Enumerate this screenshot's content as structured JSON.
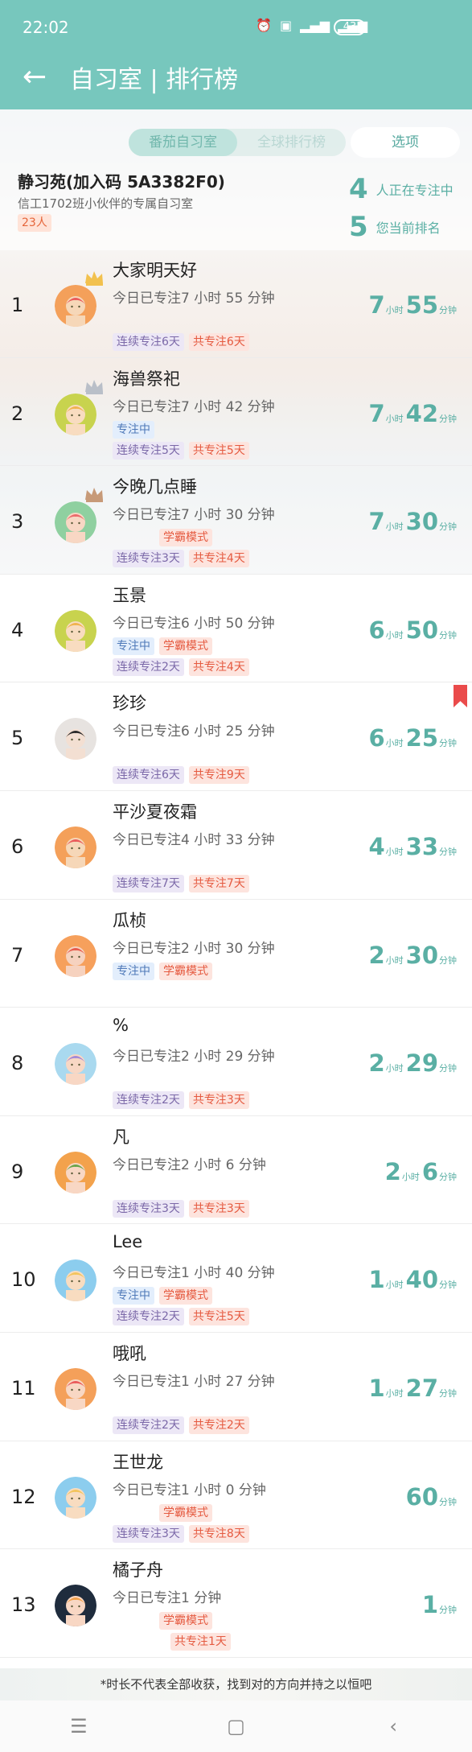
{
  "status_bar": {
    "time": "22:02",
    "icons": [
      "alarm-icon",
      "hd-icon",
      "4g-signal-icon",
      "wifi-signal-icon"
    ],
    "battery": "43"
  },
  "titlebar": {
    "back_icon": "arrow-left-icon",
    "title": "自习室 | 排行榜"
  },
  "tabs": {
    "pomodoro_room": "番茄自习室",
    "global_rank": "全球排行榜",
    "options": "选项"
  },
  "room": {
    "name": "静习苑(加入码 5A3382F0)",
    "description": "信工1702班小伙伴的专属自习室",
    "member_count": "23人",
    "focusing_count": "4",
    "focusing_label": "人正在专注中",
    "my_rank": "5",
    "my_rank_label": "您当前排名"
  },
  "labels": {
    "hour": "小时",
    "minute": "分钟"
  },
  "ranking": [
    {
      "rank": "1",
      "name": "大家明天好",
      "desc": "今日已专注7 小时 55 分钟",
      "status_tags": [],
      "tags": [
        {
          "text": "连续专注6天",
          "color": "purple"
        },
        {
          "text": "共专注6天",
          "color": "red"
        }
      ],
      "hours": "7",
      "minutes": "55",
      "crown": "gold",
      "avatar": "orange"
    },
    {
      "rank": "2",
      "name": "海兽祭祀",
      "desc": "今日已专注7 小时 42 分钟",
      "status_tags": [
        {
          "text": "专注中",
          "color": "blue"
        }
      ],
      "tags": [
        {
          "text": "连续专注5天",
          "color": "purple"
        },
        {
          "text": "共专注5天",
          "color": "red"
        }
      ],
      "hours": "7",
      "minutes": "42",
      "crown": "silver",
      "avatar": "yellow-green"
    },
    {
      "rank": "3",
      "name": "今晚几点睡",
      "desc": "今日已专注7 小时 30 分钟",
      "status_tags": [
        {
          "text": "学霸模式",
          "color": "red",
          "offset": true
        }
      ],
      "tags": [
        {
          "text": "连续专注3天",
          "color": "purple"
        },
        {
          "text": "共专注4天",
          "color": "red"
        }
      ],
      "hours": "7",
      "minutes": "30",
      "crown": "bronze",
      "avatar": "green"
    },
    {
      "rank": "4",
      "name": "玉景",
      "desc": "今日已专注6 小时 50 分钟",
      "status_tags": [
        {
          "text": "专注中",
          "color": "blue"
        },
        {
          "text": "学霸模式",
          "color": "red"
        }
      ],
      "tags": [
        {
          "text": "连续专注2天",
          "color": "purple"
        },
        {
          "text": "共专注4天",
          "color": "red"
        }
      ],
      "hours": "6",
      "minutes": "50",
      "crown": "",
      "avatar": "yellow-green"
    },
    {
      "rank": "5",
      "name": "珍珍",
      "desc": "今日已专注6 小时 25 分钟",
      "status_tags": [],
      "tags": [
        {
          "text": "连续专注6天",
          "color": "purple"
        },
        {
          "text": "共专注9天",
          "color": "red"
        }
      ],
      "hours": "6",
      "minutes": "25",
      "crown": "",
      "avatar": "photo"
    },
    {
      "rank": "6",
      "name": "平沙夏夜霜",
      "desc": "今日已专注4 小时 33 分钟",
      "status_tags": [],
      "tags": [
        {
          "text": "连续专注7天",
          "color": "purple"
        },
        {
          "text": "共专注7天",
          "color": "red"
        }
      ],
      "hours": "4",
      "minutes": "33",
      "crown": "",
      "avatar": "orange"
    },
    {
      "rank": "7",
      "name": "瓜桢",
      "desc": "今日已专注2 小时 30 分钟",
      "status_tags": [
        {
          "text": "专注中",
          "color": "blue"
        },
        {
          "text": "学霸模式",
          "color": "red"
        }
      ],
      "tags": [],
      "hours": "2",
      "minutes": "30",
      "crown": "",
      "avatar": "orange-red"
    },
    {
      "rank": "8",
      "name": "%",
      "desc": "今日已专注2 小时 29 分钟",
      "status_tags": [],
      "tags": [
        {
          "text": "连续专注2天",
          "color": "purple"
        },
        {
          "text": "共专注3天",
          "color": "red"
        }
      ],
      "hours": "2",
      "minutes": "29",
      "crown": "",
      "avatar": "blue-purple"
    },
    {
      "rank": "9",
      "name": "凡",
      "desc": "今日已专注2 小时 6 分钟",
      "status_tags": [],
      "tags": [
        {
          "text": "连续专注3天",
          "color": "purple"
        },
        {
          "text": "共专注3天",
          "color": "red"
        }
      ],
      "hours": "2",
      "minutes": "6",
      "crown": "",
      "avatar": "orange-green"
    },
    {
      "rank": "10",
      "name": "Lee",
      "desc": "今日已专注1 小时 40 分钟",
      "status_tags": [
        {
          "text": "专注中",
          "color": "blue"
        },
        {
          "text": "学霸模式",
          "color": "red"
        }
      ],
      "tags": [
        {
          "text": "连续专注2天",
          "color": "purple"
        },
        {
          "text": "共专注5天",
          "color": "red"
        }
      ],
      "hours": "1",
      "minutes": "40",
      "crown": "",
      "avatar": "blue-yellow"
    },
    {
      "rank": "11",
      "name": "哦吼",
      "desc": "今日已专注1 小时 27 分钟",
      "status_tags": [],
      "tags": [
        {
          "text": "连续专注2天",
          "color": "purple"
        },
        {
          "text": "共专注2天",
          "color": "red"
        }
      ],
      "hours": "1",
      "minutes": "27",
      "crown": "",
      "avatar": "orange-green2"
    },
    {
      "rank": "12",
      "name": "王世龙",
      "desc": "今日已专注1 小时 0 分钟",
      "status_tags": [
        {
          "text": "学霸模式",
          "color": "red",
          "offset": true
        }
      ],
      "tags": [
        {
          "text": "连续专注3天",
          "color": "purple"
        },
        {
          "text": "共专注8天",
          "color": "red"
        }
      ],
      "hours": "",
      "minutes": "60",
      "crown": "",
      "avatar": "blue-yellow"
    },
    {
      "rank": "13",
      "name": "橘子舟",
      "desc": "今日已专注1 分钟",
      "status_tags": [
        {
          "text": "学霸模式",
          "color": "red",
          "offset": true
        }
      ],
      "tags": [
        {
          "text": "共专注1天",
          "color": "red",
          "offset2": true
        }
      ],
      "hours": "",
      "minutes": "1",
      "crown": "",
      "avatar": "dark"
    }
  ],
  "footer_note": "*时长不代表全部收获，找到对的方向并持之以恒吧",
  "nav": {
    "menu_icon": "☰",
    "home_icon": "▢",
    "back_icon": "‹"
  },
  "colors": {
    "header": "#77c7bd",
    "accent": "#5aafa4",
    "bookmark": "#ea4b4b"
  }
}
